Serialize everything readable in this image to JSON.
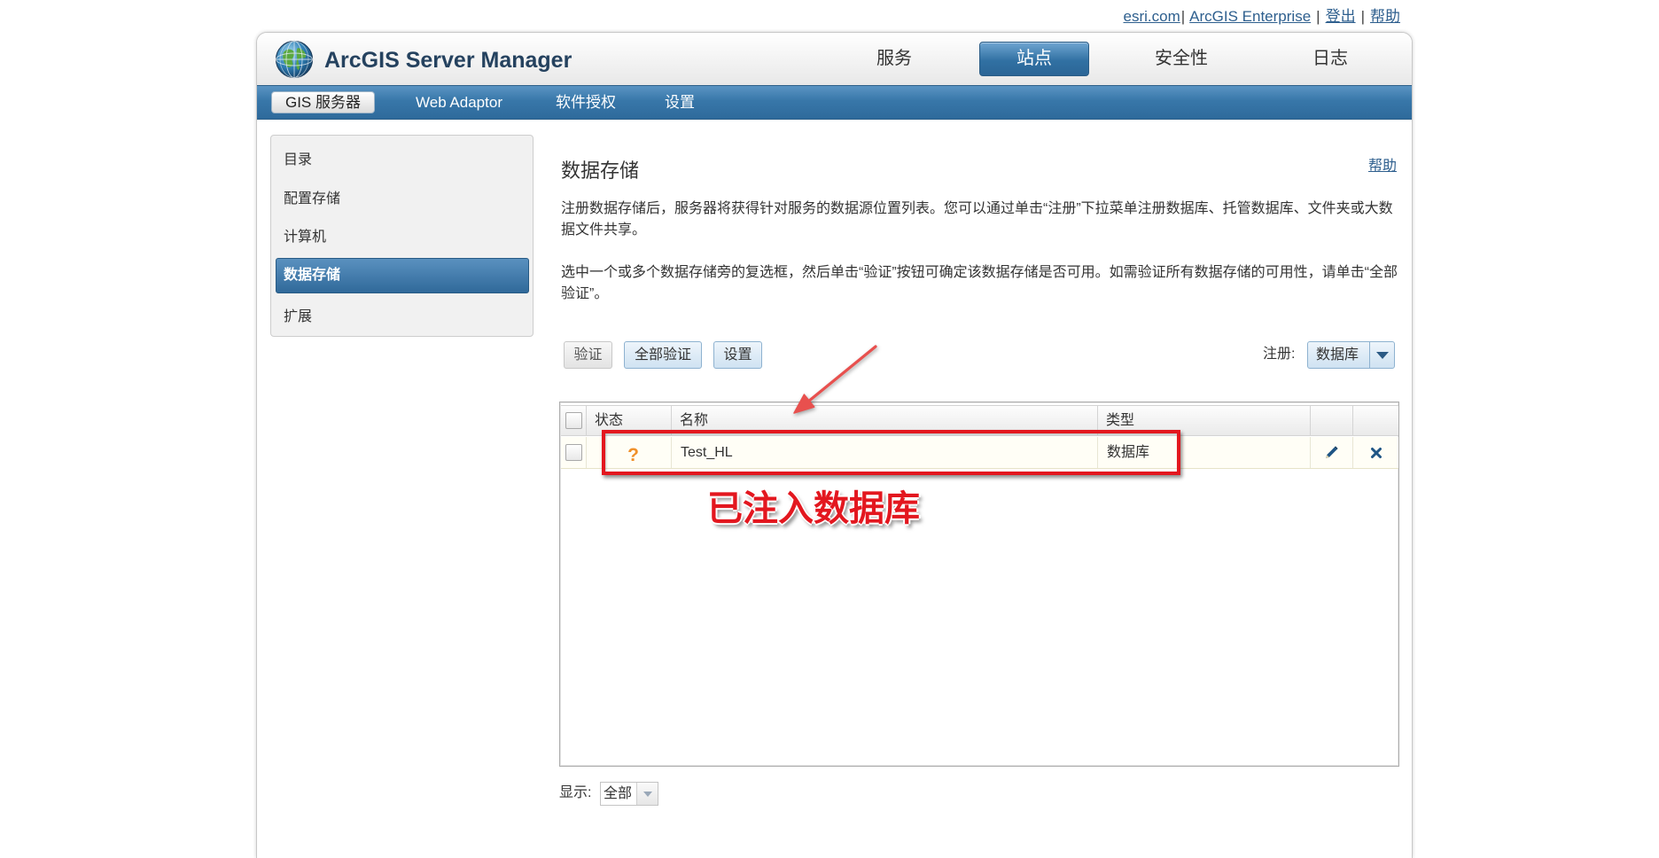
{
  "top_links": {
    "esri": "esri.com",
    "sep1": "|",
    "enterprise": "ArcGIS Enterprise",
    "sep2": "|",
    "logout": "登出",
    "sep3": "|",
    "help": "帮助"
  },
  "header": {
    "logo_icon": "globe-icon",
    "title": "ArcGIS Server Manager",
    "nav": [
      {
        "label": "服务",
        "selected": false
      },
      {
        "label": "站点",
        "selected": true
      },
      {
        "label": "安全性",
        "selected": false
      },
      {
        "label": "日志",
        "selected": false
      }
    ]
  },
  "subnav": {
    "items": [
      {
        "label": "GIS 服务器",
        "selected": true
      },
      {
        "label": "Web Adaptor",
        "selected": false
      },
      {
        "label": "软件授权",
        "selected": false
      },
      {
        "label": "设置",
        "selected": false
      }
    ]
  },
  "sidebar": {
    "items": [
      {
        "label": "目录",
        "selected": false
      },
      {
        "label": "配置存储",
        "selected": false
      },
      {
        "label": "计算机",
        "selected": false
      },
      {
        "label": "数据存储",
        "selected": true
      },
      {
        "label": "扩展",
        "selected": false
      }
    ]
  },
  "main": {
    "title": "数据存储",
    "help": "帮助",
    "paragraphs": [
      "注册数据存储后，服务器将获得针对服务的数据源位置列表。您可以通过单击“注册”下拉菜单注册数据库、托管数据库、文件夹或大数据文件共享。",
      "选中一个或多个数据存储旁的复选框，然后单击“验证”按钮可确定该数据存储是否可用。如需验证所有数据存储的可用性，请单击“全部验证”。"
    ],
    "toolbar": {
      "validate": "验证",
      "validate_all": "全部验证",
      "settings": "设置",
      "register_label": "注册:",
      "register_value": "数据库",
      "register_icon": "chevron-down-icon"
    },
    "table": {
      "columns": {
        "status": "状态",
        "name": "名称",
        "type": "类型"
      },
      "rows": [
        {
          "checked": false,
          "status_icon": "question-icon",
          "status_glyph": "?",
          "name": "Test_HL",
          "type": "数据库",
          "edit_icon": "pencil-icon",
          "delete_icon": "close-icon"
        }
      ]
    },
    "footer": {
      "show_label": "显示:",
      "show_value": "全部"
    }
  },
  "annotation": {
    "text": "已注入数据库"
  },
  "colors": {
    "nav_blue": "#3171a3",
    "link_blue": "#2e5f8e",
    "status_orange": "#f0902a",
    "annotation_red": "#e3171f"
  }
}
